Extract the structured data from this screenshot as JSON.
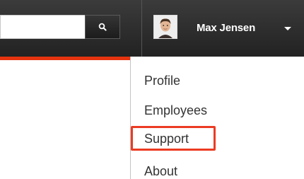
{
  "search": {
    "value": "",
    "placeholder": "",
    "button_icon": "search-icon"
  },
  "user": {
    "name": "Max Jensen",
    "avatar_icon": "avatar-photo",
    "caret_icon": "caret-down-icon"
  },
  "menu": {
    "items": [
      {
        "label": "Profile"
      },
      {
        "label": "Employees"
      },
      {
        "label": "Support"
      },
      {
        "label": "About"
      }
    ],
    "highlighted": "Support"
  },
  "colors": {
    "topbar": "#2c2c2c",
    "accent_red": "#e5330f",
    "highlight_border": "#ec3b23",
    "menu_text": "#333333"
  }
}
